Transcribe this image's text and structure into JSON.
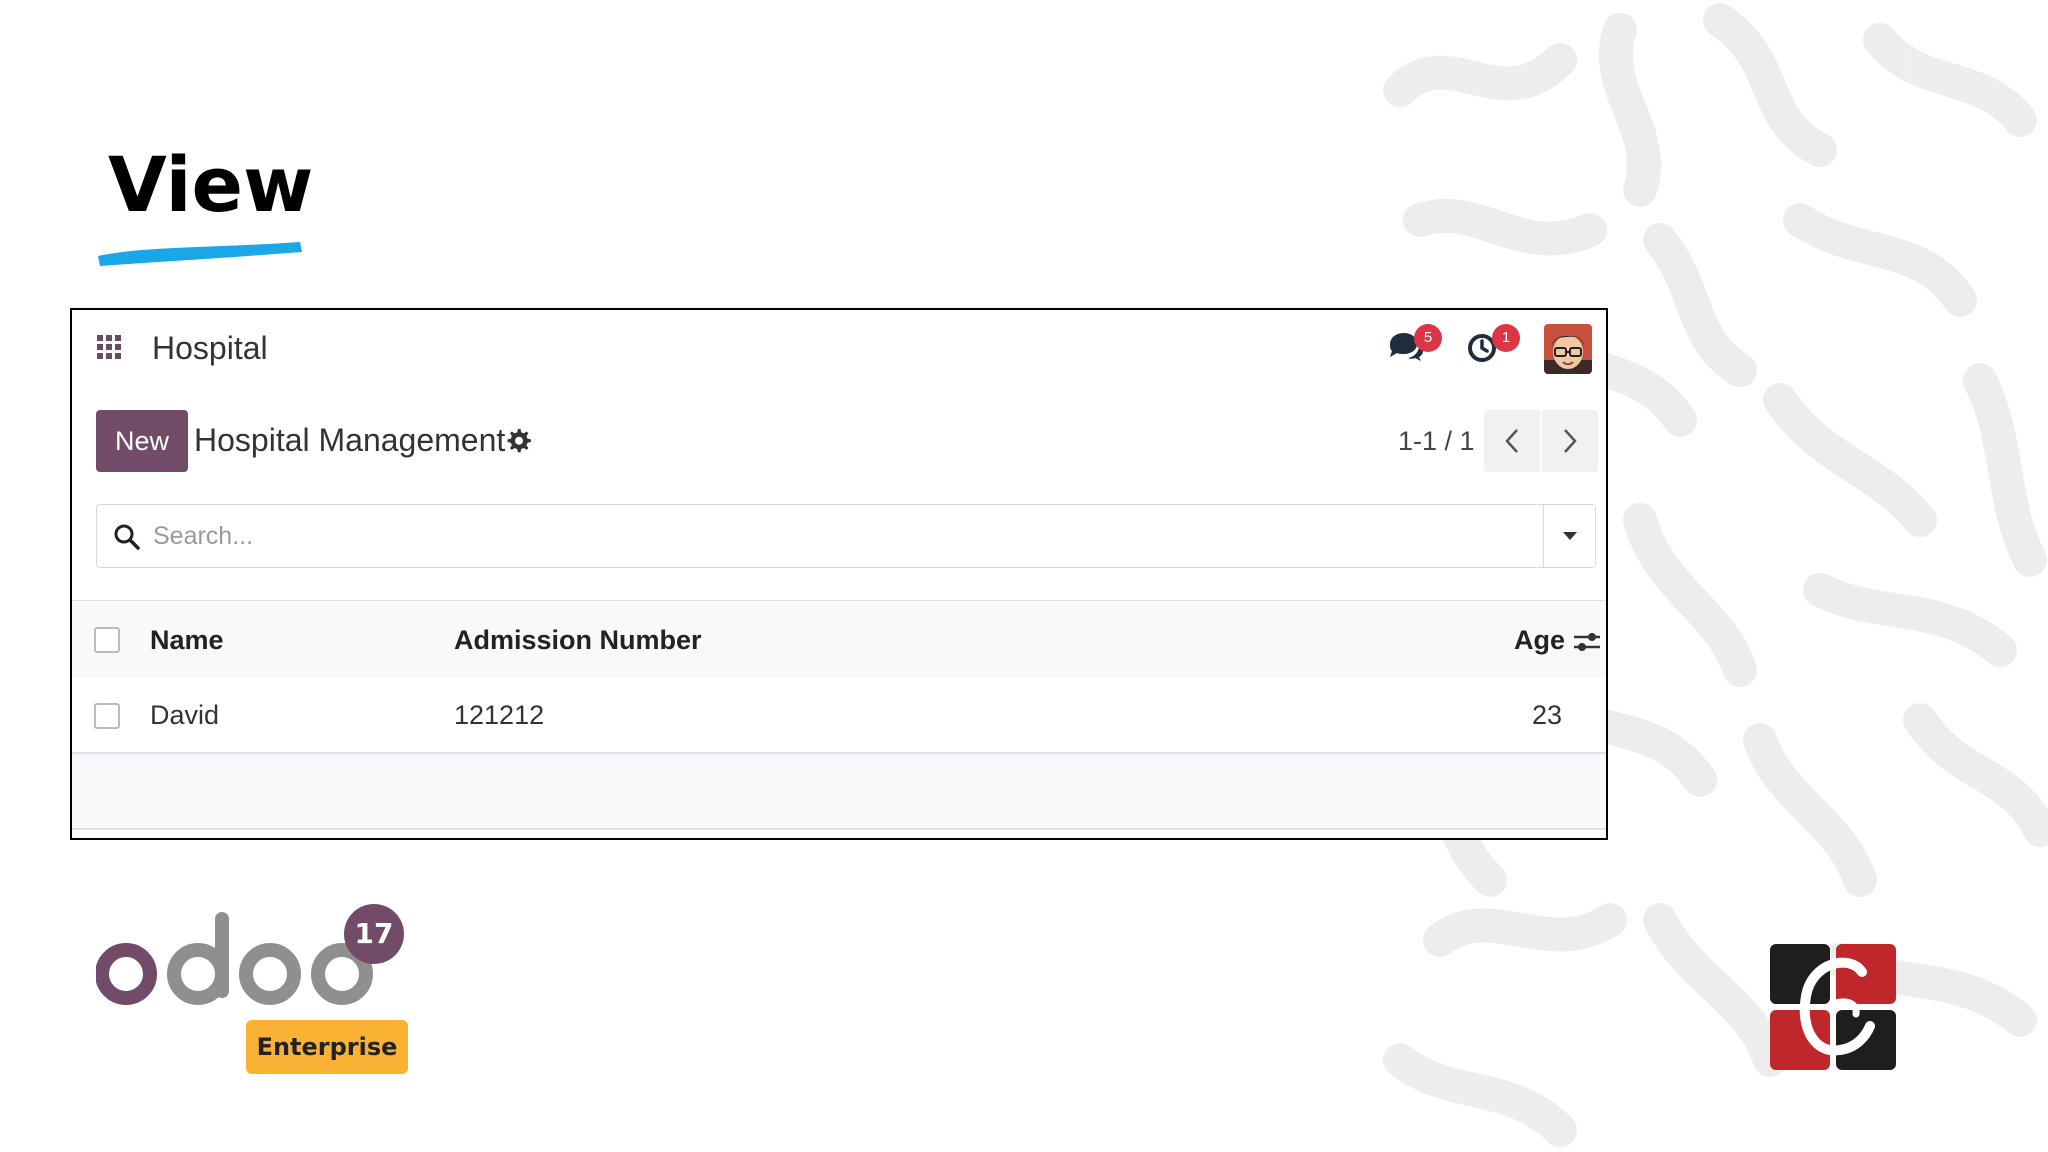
{
  "slide": {
    "title": "View"
  },
  "navbar": {
    "app_name": "Hospital",
    "messages_count": "5",
    "activities_count": "1"
  },
  "control_panel": {
    "new_label": "New",
    "breadcrumb": "Hospital Management",
    "pager_value": "1-1 / 1"
  },
  "search": {
    "placeholder": "Search..."
  },
  "list": {
    "columns": [
      "Name",
      "Admission Number",
      "Age"
    ],
    "rows": [
      {
        "name": "David",
        "admission_number": "121212",
        "age": "23"
      }
    ]
  },
  "branding": {
    "version": "17",
    "edition": "Enterprise",
    "logo_text": "odoo"
  },
  "colors": {
    "brand": "#714b67",
    "accent_underline": "#1aa7e8",
    "badge": "#dc3545",
    "enterprise_badge": "#f9b234"
  }
}
